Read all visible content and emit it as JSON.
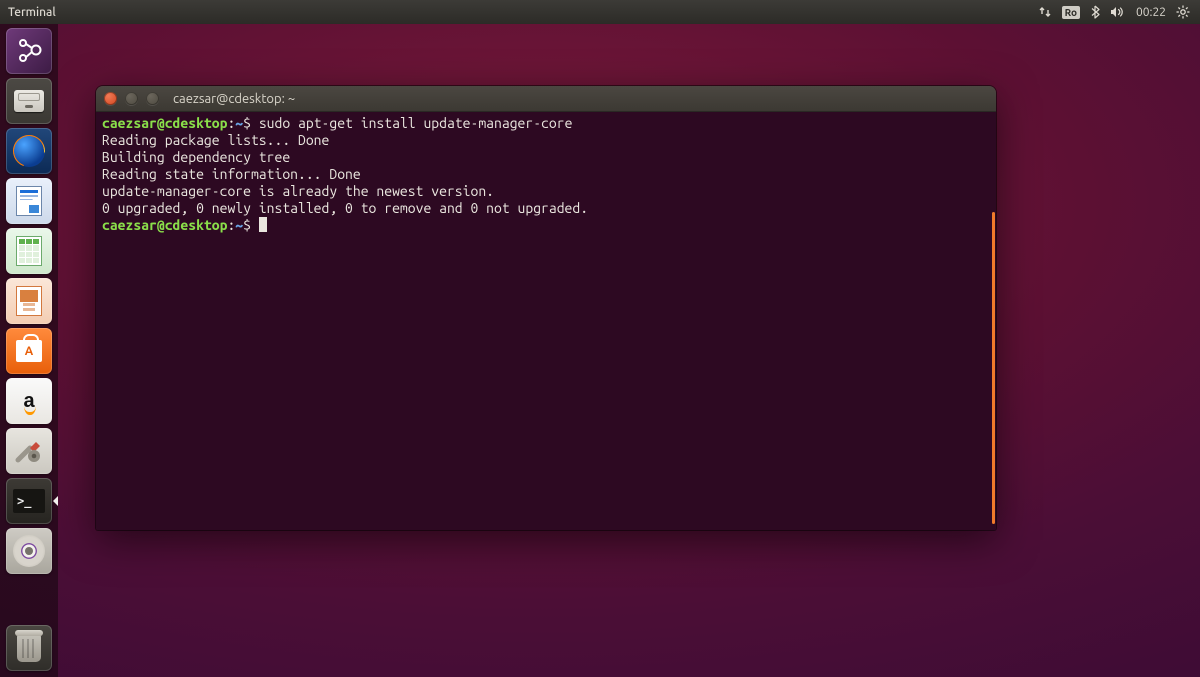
{
  "menubar": {
    "app_label": "Terminal",
    "keyboard_layout": "Ro",
    "clock": "00:22"
  },
  "launcher": {
    "items": [
      {
        "name": "dash",
        "tooltip": "Dash"
      },
      {
        "name": "files",
        "tooltip": "Files"
      },
      {
        "name": "firefox",
        "tooltip": "Firefox Web Browser"
      },
      {
        "name": "writer",
        "tooltip": "LibreOffice Writer"
      },
      {
        "name": "calc",
        "tooltip": "LibreOffice Calc"
      },
      {
        "name": "impress",
        "tooltip": "LibreOffice Impress"
      },
      {
        "name": "software",
        "tooltip": "Ubuntu Software"
      },
      {
        "name": "amazon",
        "tooltip": "Amazon"
      },
      {
        "name": "settings",
        "tooltip": "System Settings"
      },
      {
        "name": "terminal",
        "tooltip": "Terminal"
      },
      {
        "name": "dvd",
        "tooltip": "Disc"
      }
    ],
    "trash_tooltip": "Trash",
    "active": "terminal"
  },
  "terminal": {
    "window_title": "caezsar@cdesktop: ~",
    "prompt_user": "caezsar@cdesktop",
    "prompt_path": "~",
    "prompt_symbol": "$",
    "command": "sudo apt-get install update-manager-core",
    "output_lines": [
      "Reading package lists... Done",
      "Building dependency tree",
      "Reading state information... Done",
      "update-manager-core is already the newest version.",
      "0 upgraded, 0 newly installed, 0 to remove and 0 not upgraded."
    ]
  }
}
